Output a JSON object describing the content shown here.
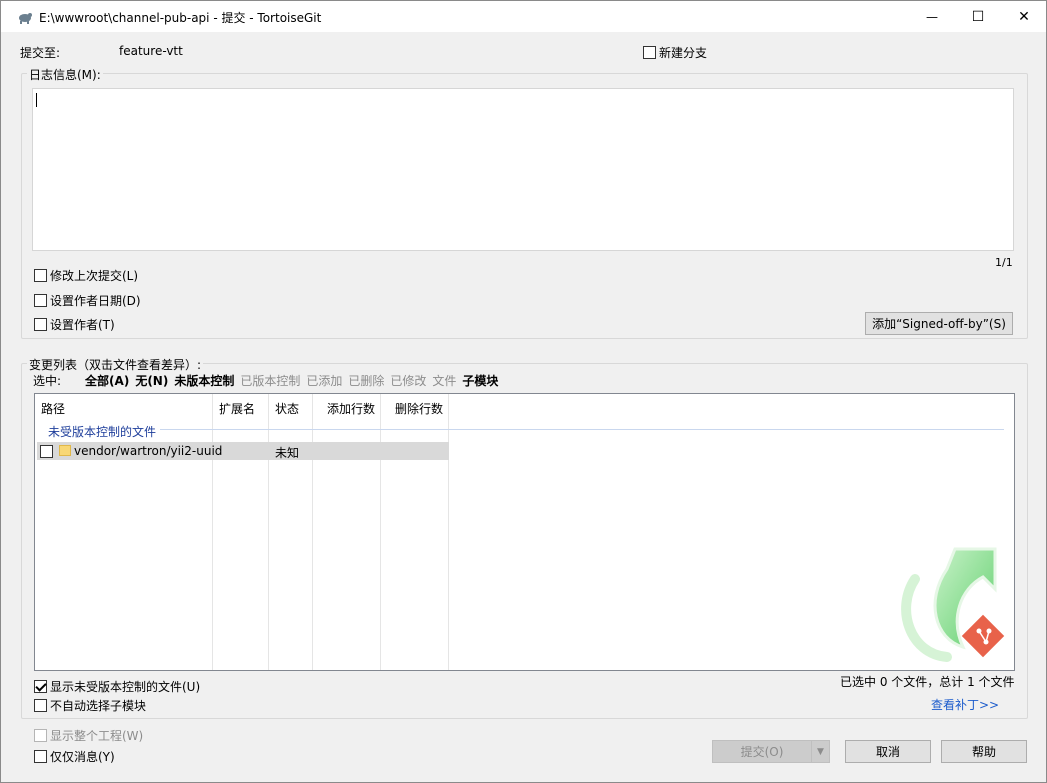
{
  "window": {
    "title": "E:\\wwwroot\\channel-pub-api - 提交 - TortoiseGit",
    "minimize_glyph": "—",
    "maximize_glyph": "☐",
    "close_glyph": "✕"
  },
  "commit_to": {
    "label": "提交至:",
    "branch": "feature-vtt",
    "new_branch_label": "新建分支",
    "new_branch_checked": false
  },
  "message": {
    "group_label": "日志信息(M):",
    "value": "",
    "counter": "1/1",
    "amend_label": "修改上次提交(L)",
    "set_date_label": "设置作者日期(D)",
    "set_author_label": "设置作者(T)",
    "signoff_button": "添加“Signed-off-by”(S)"
  },
  "changes": {
    "group_label": "变更列表（双击文件查看差异）:",
    "filter_label": "选中:",
    "filters": [
      {
        "label": "全部(A)",
        "enabled": true
      },
      {
        "label": "无(N)",
        "enabled": true
      },
      {
        "label": "未版本控制",
        "enabled": true
      },
      {
        "label": "已版本控制",
        "enabled": false
      },
      {
        "label": "已添加",
        "enabled": false
      },
      {
        "label": "已删除",
        "enabled": false
      },
      {
        "label": "已修改",
        "enabled": false
      },
      {
        "label": "文件",
        "enabled": false
      },
      {
        "label": "子模块",
        "enabled": true
      }
    ],
    "columns": [
      "路径",
      "扩展名",
      "状态",
      "添加行数",
      "删除行数"
    ],
    "group_header": "未受版本控制的文件",
    "rows": [
      {
        "path": "vendor/wartron/yii2-uuid",
        "ext": "",
        "status": "未知",
        "added": "",
        "deleted": "",
        "checked": false
      }
    ],
    "show_unversioned_label": "显示未受版本控制的文件(U)",
    "show_unversioned_checked": true,
    "no_autoselect_submodules_label": "不自动选择子模块",
    "selection_summary": "已选中 0 个文件，总计 1 个文件",
    "view_patch_link": "查看补丁>>"
  },
  "footer": {
    "whole_project_label": "显示整个工程(W)",
    "message_only_label": "仅仅消息(Y)",
    "commit_button": "提交(O)",
    "cancel_button": "取消",
    "help_button": "帮助"
  },
  "colors": {
    "logo_green": "#7fd88a",
    "git_badge": "#e8624a",
    "link": "#1c5ccc"
  }
}
